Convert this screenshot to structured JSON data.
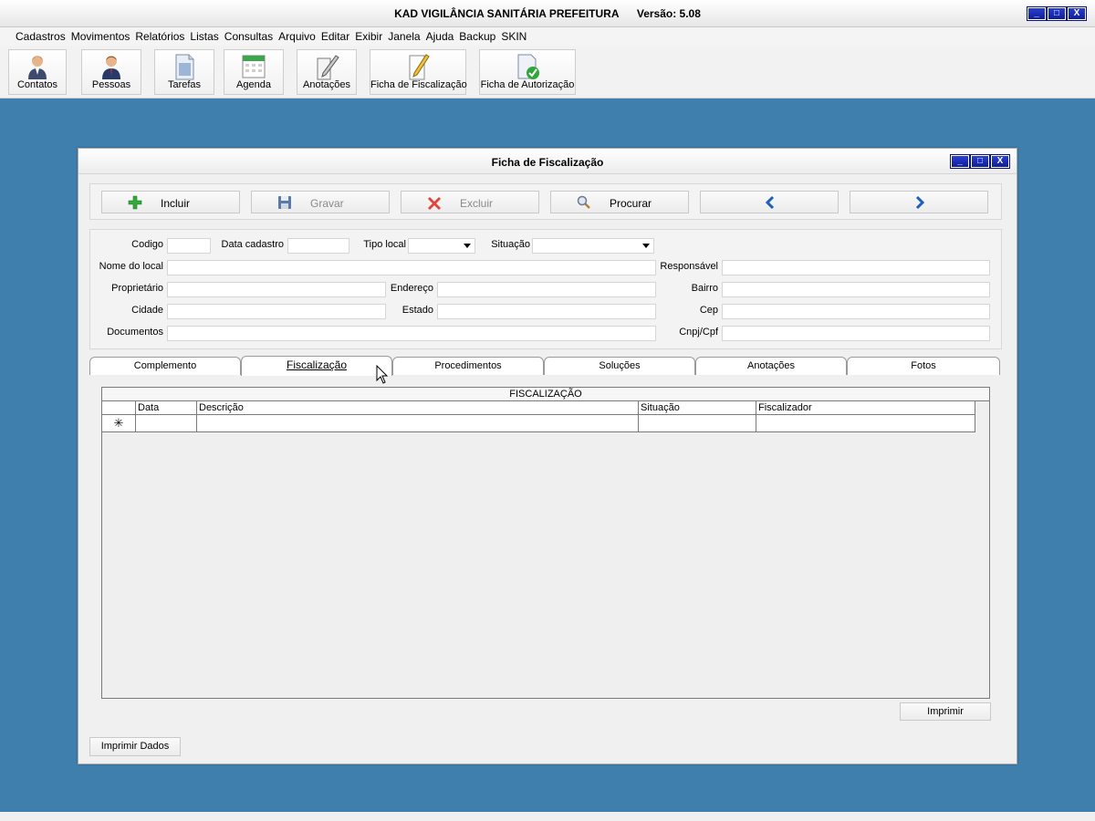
{
  "app": {
    "title": "KAD VIGILÂNCIA SANITÁRIA PREFEITURA",
    "version": "Versão: 5.08",
    "window_buttons": [
      "_",
      "□",
      "X"
    ]
  },
  "menu": [
    "Cadastros",
    "Movimentos",
    "Relatórios",
    "Listas",
    "Consultas",
    "Arquivo",
    "Editar",
    "Exibir",
    "Janela",
    "Ajuda",
    "Backup",
    "SKIN"
  ],
  "toolbar": [
    {
      "label": "Contatos",
      "icon": "contact-person-icon"
    },
    {
      "label": "Pessoas",
      "icon": "people-icon"
    },
    {
      "label": "Tarefas",
      "icon": "tasks-document-icon"
    },
    {
      "label": "Agenda",
      "icon": "calendar-icon"
    },
    {
      "label": "Anotações",
      "icon": "notes-pencil-icon"
    },
    {
      "label": "Ficha de Fiscalização",
      "icon": "inspection-form-icon"
    },
    {
      "label": "Ficha de Autorização",
      "icon": "authorization-form-icon"
    }
  ],
  "child": {
    "title": "Ficha de Fiscalização",
    "window_buttons": [
      "_",
      "□",
      "X"
    ],
    "actions": {
      "incluir": "Incluir",
      "gravar": "Gravar",
      "excluir": "Excluir",
      "procurar": "Procurar"
    },
    "form": {
      "codigo": {
        "label": "Codigo",
        "value": ""
      },
      "data_cadastro": {
        "label": "Data cadastro",
        "value": ""
      },
      "tipo_local": {
        "label": "Tipo local",
        "value": ""
      },
      "situacao": {
        "label": "Situação",
        "value": ""
      },
      "nome_local": {
        "label": "Nome do local",
        "value": ""
      },
      "responsavel": {
        "label": "Responsável",
        "value": ""
      },
      "proprietario": {
        "label": "Proprietário",
        "value": ""
      },
      "endereco": {
        "label": "Endereço",
        "value": ""
      },
      "bairro": {
        "label": "Bairro",
        "value": ""
      },
      "cidade": {
        "label": "Cidade",
        "value": ""
      },
      "estado": {
        "label": "Estado",
        "value": ""
      },
      "cep": {
        "label": "Cep",
        "value": ""
      },
      "documentos": {
        "label": "Documentos",
        "value": ""
      },
      "cnpj_cpf": {
        "label": "Cnpj/Cpf",
        "value": ""
      }
    },
    "tabs": [
      "Complemento",
      "Fiscalização",
      "Procedimentos",
      "Soluções",
      "Anotações",
      "Fotos"
    ],
    "active_tab": "Fiscalização",
    "grid": {
      "caption": "FISCALIZAÇÃO",
      "columns": [
        "Data",
        "Descrição",
        "Situação",
        "Fiscalizador"
      ],
      "new_row_marker": "✳"
    },
    "print_label": "Imprimir",
    "print_data_label": "Imprimir Dados"
  },
  "colors": {
    "desktop": "#3f7fae",
    "window_button": "#1a2bc0",
    "incluir_icon": "#2e9e2e",
    "excluir_icon": "#d9302b",
    "nav_arrow": "#1d5fbf"
  }
}
